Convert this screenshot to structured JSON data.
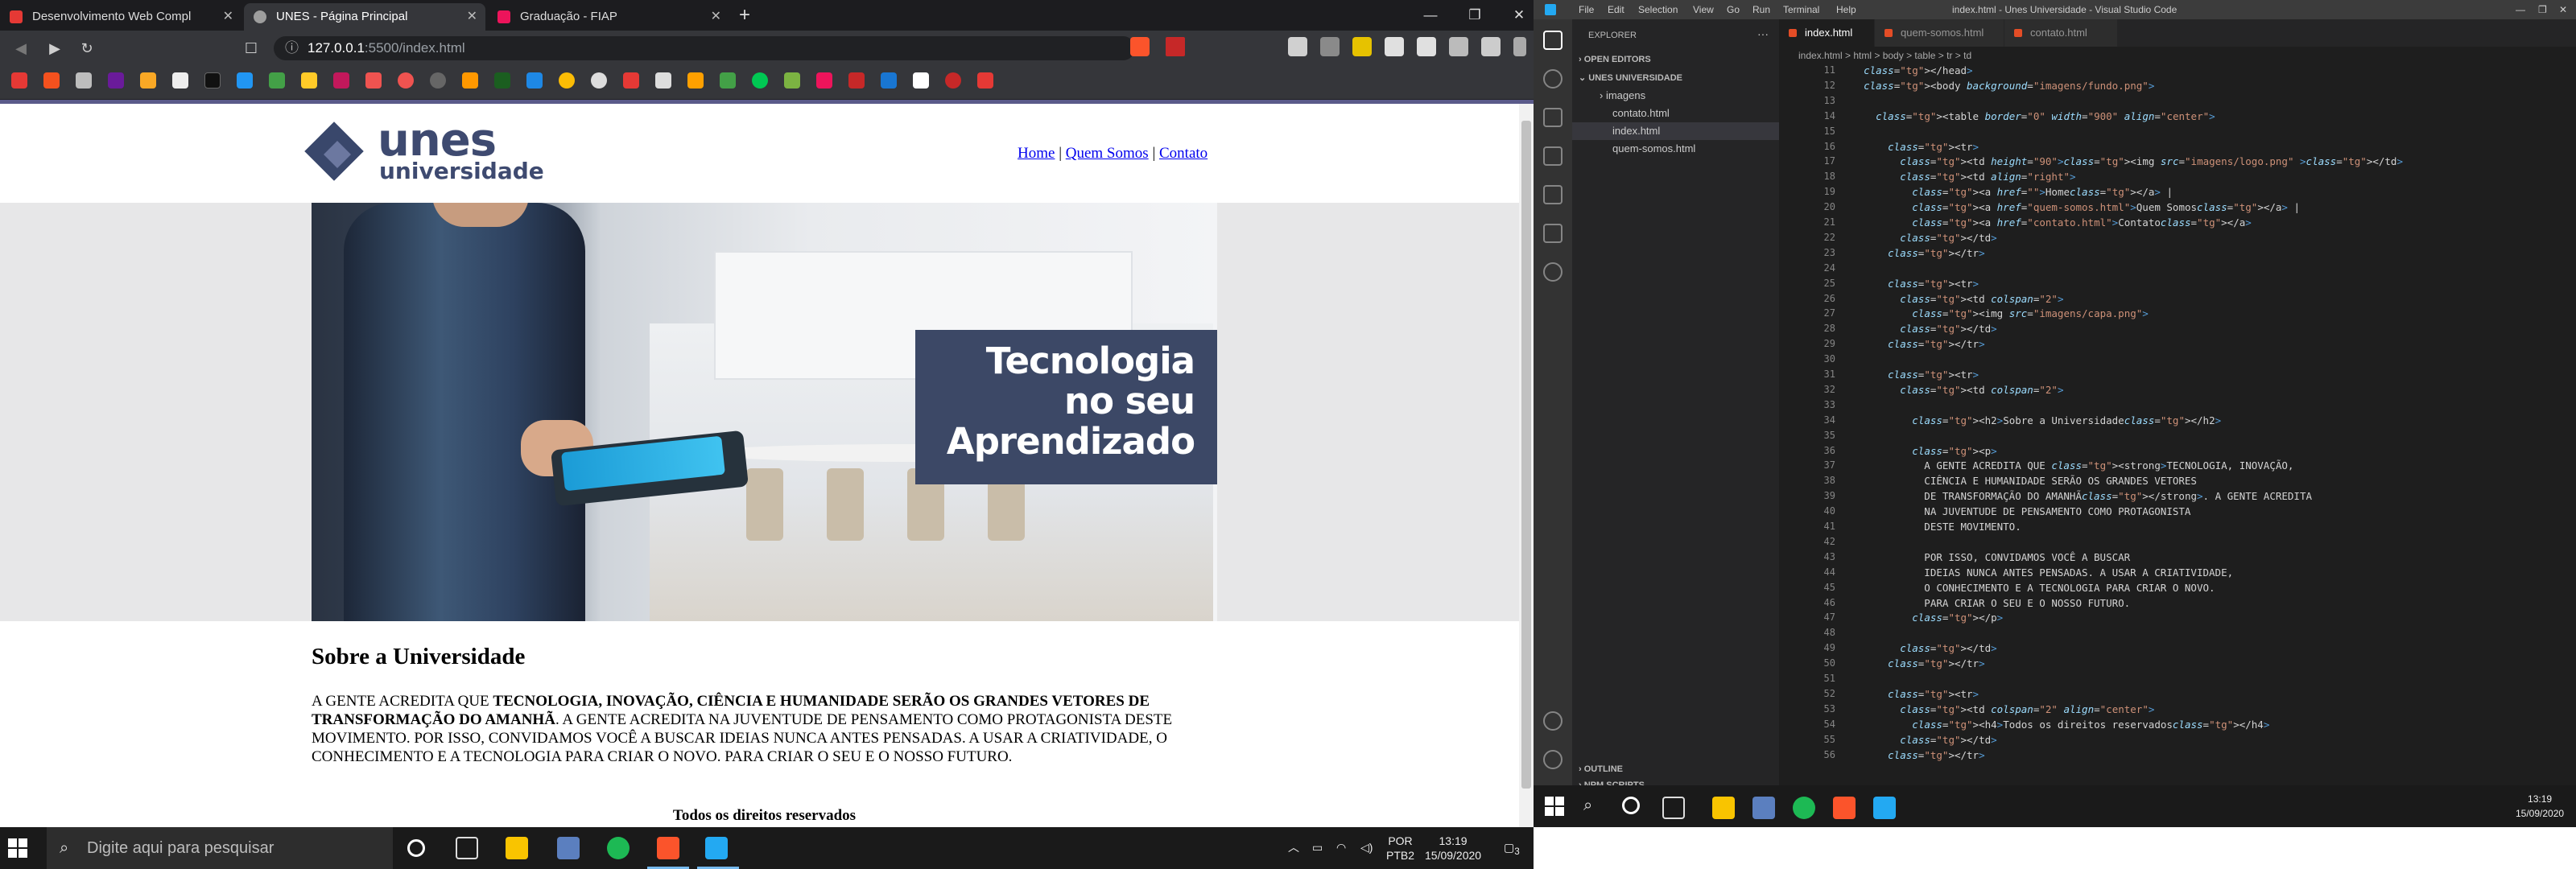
{
  "browser": {
    "tabs": [
      {
        "label": "Desenvolvimento Web Compl",
        "color": "#e53935"
      },
      {
        "label": "UNES - Página Principal",
        "color": "#9e9e9e"
      },
      {
        "label": "Graduação - FIAP",
        "color": "#ed145b"
      }
    ],
    "url_host": "127.0.0.1",
    "url_path": ":5500/index.html"
  },
  "site": {
    "logo_main": "unes",
    "logo_sub": "universidade",
    "nav": [
      "Home",
      "Quem Somos",
      "Contato"
    ],
    "nav_sep": "|",
    "banner": [
      "Tecnologia",
      "no seu",
      "Aprendizado"
    ],
    "heading": "Sobre a Universidade",
    "para_lead": "A GENTE ACREDITA QUE ",
    "para_strong": "TECNOLOGIA, INOVAÇÃO, CIÊNCIA E HUMANIDADE SERÃO OS GRANDES VETORES DE TRANSFORMAÇÃO DO AMANHÃ",
    "para_rest": ". A GENTE ACREDITA NA JUVENTUDE DE PENSAMENTO COMO PROTAGONISTA DESTE MOVIMENTO. POR ISSO, CONVIDAMOS VOCÊ A BUSCAR IDEIAS NUNCA ANTES PENSADAS. A USAR A CRIATIVIDADE, O CONHECIMENTO E A TECNOLOGIA PARA CRIAR O NOVO. PARA CRIAR O SEU E O NOSSO FUTURO.",
    "footer": "Todos os direitos reservados"
  },
  "taskbar": {
    "search_placeholder": "Digite aqui para pesquisar",
    "lang": "POR",
    "layout": "PTB2",
    "time": "13:19",
    "date": "15/09/2020",
    "notif": "3"
  },
  "vscode": {
    "menu": [
      "File",
      "Edit",
      "Selection",
      "View",
      "Go",
      "Run",
      "Terminal",
      "Help"
    ],
    "title": "index.html - Unes Universidade - Visual Studio Code",
    "explorer": "EXPLORER",
    "open_editors": "OPEN EDITORS",
    "project": "UNES UNIVERSIDADE",
    "files": [
      "imagens",
      "contato.html",
      "index.html",
      "quem-somos.html"
    ],
    "outline": "OUTLINE",
    "npm": "NPM SCRIPTS",
    "tabs": [
      "index.html",
      "quem-somos.html",
      "contato.html"
    ],
    "breadcrumbs": "index.html > html > body > table > tr > td",
    "code": [
      {
        "n": "11",
        "t": "  </head>"
      },
      {
        "n": "12",
        "t": "  <body background=\"imagens/fundo.png\">"
      },
      {
        "n": "13",
        "t": ""
      },
      {
        "n": "14",
        "t": "    <table border=\"0\" width=\"900\" align=\"center\">"
      },
      {
        "n": "15",
        "t": ""
      },
      {
        "n": "16",
        "t": "      <tr>"
      },
      {
        "n": "17",
        "t": "        <td height=\"90\"><img src=\"imagens/logo.png\" ></td>"
      },
      {
        "n": "18",
        "t": "        <td align=\"right\">"
      },
      {
        "n": "19",
        "t": "          <a href=\"\">Home</a> |"
      },
      {
        "n": "20",
        "t": "          <a href=\"quem-somos.html\">Quem Somos</a> |"
      },
      {
        "n": "21",
        "t": "          <a href=\"contato.html\">Contato</a>"
      },
      {
        "n": "22",
        "t": "        </td>"
      },
      {
        "n": "23",
        "t": "      </tr>"
      },
      {
        "n": "24",
        "t": ""
      },
      {
        "n": "25",
        "t": "      <tr>"
      },
      {
        "n": "26",
        "t": "        <td colspan=\"2\">"
      },
      {
        "n": "27",
        "t": "          <img src=\"imagens/capa.png\">"
      },
      {
        "n": "28",
        "t": "        </td>"
      },
      {
        "n": "29",
        "t": "      </tr>"
      },
      {
        "n": "30",
        "t": ""
      },
      {
        "n": "31",
        "t": "      <tr>"
      },
      {
        "n": "32",
        "t": "        <td colspan=\"2\">"
      },
      {
        "n": "33",
        "t": ""
      },
      {
        "n": "34",
        "t": "          <h2>Sobre a Universidade</h2>"
      },
      {
        "n": "35",
        "t": ""
      },
      {
        "n": "36",
        "t": "          <p>"
      },
      {
        "n": "37",
        "t": "            A GENTE ACREDITA QUE <strong>TECNOLOGIA, INOVAÇÃO,"
      },
      {
        "n": "38",
        "t": "            CIÊNCIA E HUMANIDADE SERÃO OS GRANDES VETORES"
      },
      {
        "n": "39",
        "t": "            DE TRANSFORMAÇÃO DO AMANHÃ</strong>. A GENTE ACREDITA"
      },
      {
        "n": "40",
        "t": "            NA JUVENTUDE DE PENSAMENTO COMO PROTAGONISTA"
      },
      {
        "n": "41",
        "t": "            DESTE MOVIMENTO."
      },
      {
        "n": "42",
        "t": ""
      },
      {
        "n": "43",
        "t": "            POR ISSO, CONVIDAMOS VOCÊ A BUSCAR"
      },
      {
        "n": "44",
        "t": "            IDEIAS NUNCA ANTES PENSADAS. A USAR A CRIATIVIDADE,"
      },
      {
        "n": "45",
        "t": "            O CONHECIMENTO E A TECNOLOGIA PARA CRIAR O NOVO."
      },
      {
        "n": "46",
        "t": "            PARA CRIAR O SEU E O NOSSO FUTURO."
      },
      {
        "n": "47",
        "t": "          </p>"
      },
      {
        "n": "48",
        "t": ""
      },
      {
        "n": "49",
        "t": "        </td>"
      },
      {
        "n": "50",
        "t": "      </tr>"
      },
      {
        "n": "51",
        "t": ""
      },
      {
        "n": "52",
        "t": "      <tr>"
      },
      {
        "n": "53",
        "t": "        <td colspan=\"2\" align=\"center\">"
      },
      {
        "n": "54",
        "t": "          <h4>Todos os direitos reservados</h4>"
      },
      {
        "n": "55",
        "t": "        </td>"
      },
      {
        "n": "56",
        "t": "      </tr>"
      }
    ],
    "status_time": "13:19",
    "status_date": "15/09/2020"
  }
}
